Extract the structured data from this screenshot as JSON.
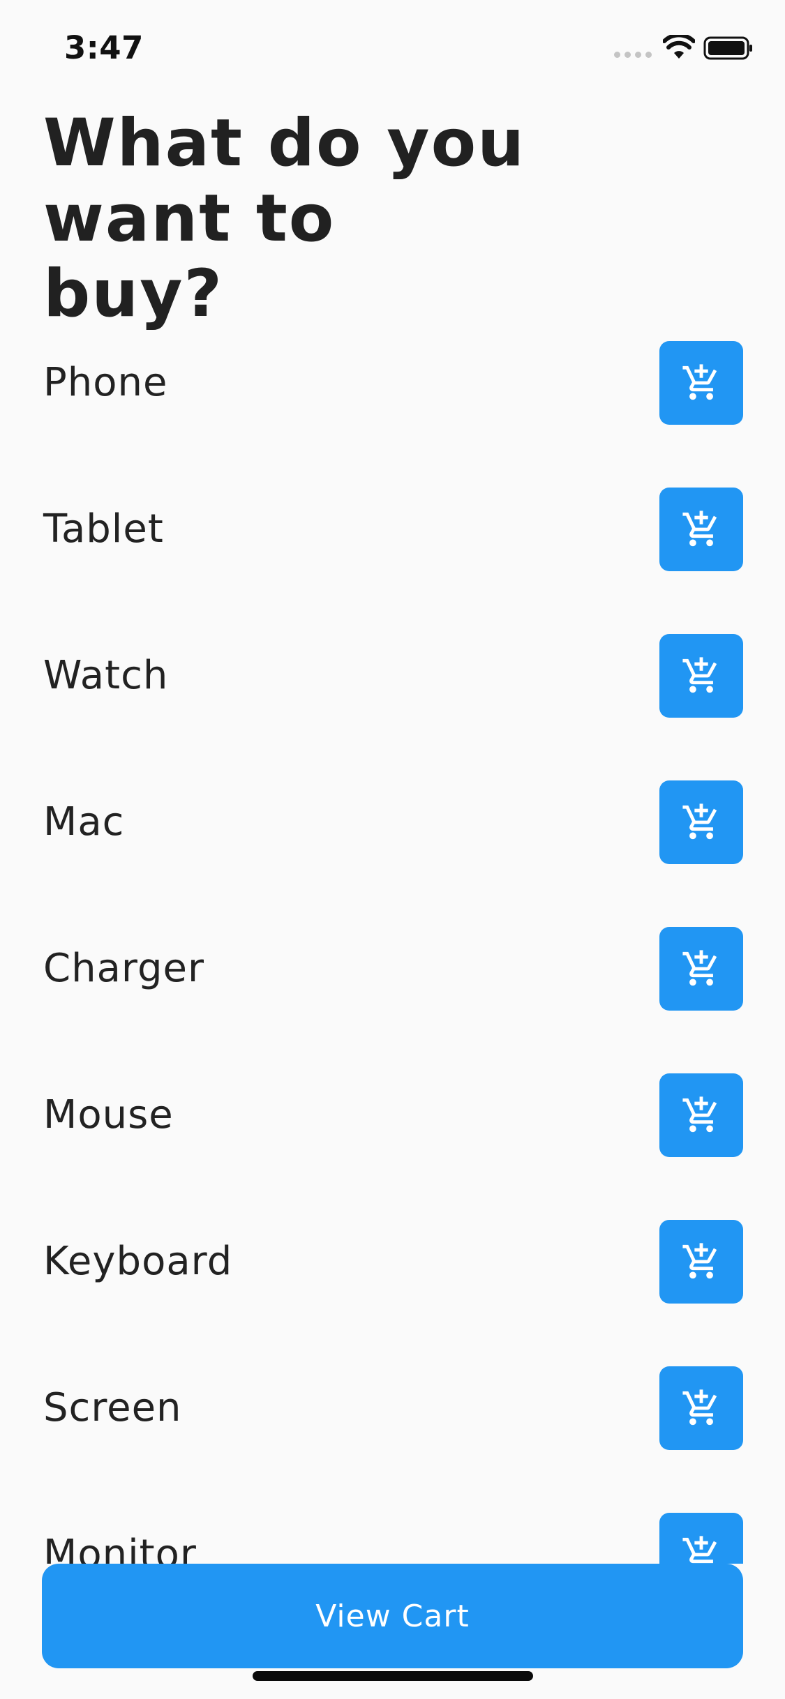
{
  "status_bar": {
    "time": "3:47",
    "icons": [
      "signal-dots-icon",
      "wifi-icon",
      "battery-icon"
    ]
  },
  "page_title": "What do you want to buy?",
  "products": [
    {
      "name": "Phone",
      "button_icon": "add-shopping-cart-icon"
    },
    {
      "name": "Tablet",
      "button_icon": "add-shopping-cart-icon"
    },
    {
      "name": "Watch",
      "button_icon": "add-shopping-cart-icon"
    },
    {
      "name": "Mac",
      "button_icon": "add-shopping-cart-icon"
    },
    {
      "name": "Charger",
      "button_icon": "add-shopping-cart-icon"
    },
    {
      "name": "Mouse",
      "button_icon": "add-shopping-cart-icon"
    },
    {
      "name": "Keyboard",
      "button_icon": "add-shopping-cart-icon"
    },
    {
      "name": "Screen",
      "button_icon": "add-shopping-cart-icon"
    },
    {
      "name": "Monitor",
      "button_icon": "add-shopping-cart-icon"
    }
  ],
  "view_cart_label": "View Cart",
  "colors": {
    "accent": "#2196f3",
    "background": "#fafafa",
    "text": "#222222",
    "icon": "#ffffff"
  }
}
